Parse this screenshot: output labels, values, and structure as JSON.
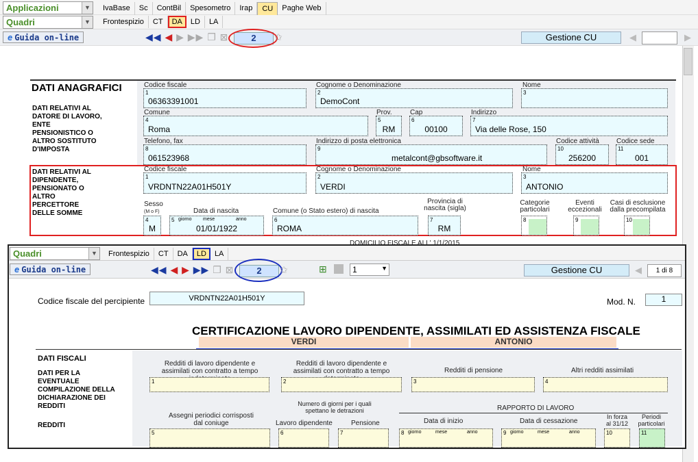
{
  "top": {
    "applicazioni": "Applicazioni",
    "quadri": "Quadri",
    "app_tabs": [
      "IvaBase",
      "Sc",
      "ContBil",
      "Spesometro",
      "Irap",
      "CU",
      "Paghe Web"
    ],
    "quadri_tabs": [
      "Frontespizio",
      "CT",
      "DA",
      "LD",
      "LA"
    ],
    "guida": "Guida on-line",
    "page": "2",
    "gestione": "Gestione CU"
  },
  "form": {
    "title": "DATI ANAGRAFICI",
    "datore_label": "DATI RELATIVI AL DATORE DI LAVORO, ENTE PENSIONISTICO O ALTRO SOSTITUTO D'IMPOSTA",
    "dip_label": "DATI RELATIVI AL DIPENDENTE, PENSIONATO O ALTRO PERCETTORE DELLE SOMME",
    "l_cf": "Codice fiscale",
    "l_cognome": "Cognome o Denominazione",
    "l_nome": "Nome",
    "l_comune": "Comune",
    "l_prov": "Prov.",
    "l_cap": "Cap",
    "l_indirizzo": "Indirizzo",
    "l_tel": "Telefono, fax",
    "l_email": "Indirizzo di posta elettronica",
    "l_codatt": "Codice attività",
    "l_codsede": "Codice sede",
    "cf_datore": "06363391001",
    "denominazione": "DemoCont",
    "comune": "Roma",
    "prov": "RM",
    "cap": "00100",
    "indirizzo": "Via delle Rose, 150",
    "telefono": "061523968",
    "email": "metalcont@gbsoftware.it",
    "codice_attivita": "256200",
    "codice_sede": "001",
    "cf_dip": "VRDNTN22A01H501Y",
    "cognome": "VERDI",
    "nome": "ANTONIO",
    "l_sesso": "Sesso",
    "l_sesso2": "(M o F)",
    "l_data_nascita": "Data di nascita",
    "l_comune_nascita": "Comune (o Stato estero) di nascita",
    "l_prov_nascita": "Provincia di nascita (sigla)",
    "l_cat": "Categorie particolari",
    "l_eventi": "Eventi eccezionali",
    "l_casi": "Casi di esclusione dalla precompilata",
    "l_giorno": "giorno",
    "l_mese": "mese",
    "l_anno": "anno",
    "sesso": "M",
    "data_nascita": "01/01/1922",
    "comune_nascita": "ROMA",
    "prov_nascita": "RM",
    "domicilio": "DOMICILIO FISCALE ALL' 1/1/2015"
  },
  "overlay": {
    "quadri": "Quadri",
    "tabs": [
      "Frontespizio",
      "CT",
      "DA",
      "LD",
      "LA"
    ],
    "guida": "Guida on-line",
    "page": "2",
    "select_val": "1",
    "gestione": "Gestione CU",
    "pager": "1 di 8",
    "l_cf_perc": "Codice fiscale del percipiente",
    "cf_perc": "VRDNTN22A01H501Y",
    "l_mod": "Mod. N.",
    "mod": "1",
    "title": "CERTIFICAZIONE LAVORO DIPENDENTE, ASSIMILATI ED ASSISTENZA FISCALE",
    "cognome": "VERDI",
    "nome": "ANTONIO",
    "s_fiscali": "DATI FISCALI",
    "s_dich": "DATI PER LA EVENTUALE COMPILAZIONE DELLA DICHIARAZIONE DEI REDDITI",
    "s_redditi": "REDDITI",
    "c1": "Redditi di lavoro dipendente e assimilati con contratto a tempo indeterminato",
    "c2": "Redditi di lavoro dipendente e assimilati con contratto a tempo determinato",
    "c3": "Redditi di pensione",
    "c4": "Altri redditi assimilati",
    "c5": "Assegni periodici corrisposti dal coniuge",
    "num_giorni": "Numero di giorni per i quali spettano le detrazioni",
    "c6": "Lavoro dipendente",
    "c7": "Pensione",
    "rapporto": "RAPPORTO DI LAVORO",
    "c8": "Data di inizio",
    "c9": "Data di cessazione",
    "c10": "In forza al 31/12",
    "c11": "Periodi particolari"
  }
}
